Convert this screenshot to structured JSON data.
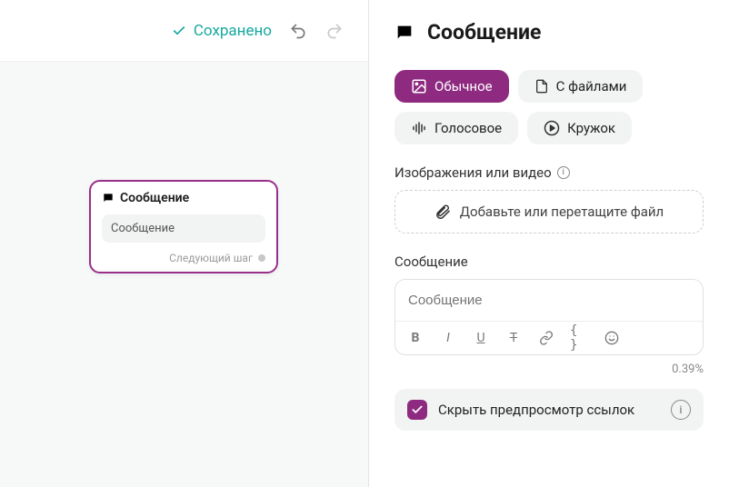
{
  "header": {
    "saved_label": "Сохранено"
  },
  "node": {
    "title": "Сообщение",
    "body": "Сообщение",
    "next_label": "Следующий шаг"
  },
  "panel": {
    "title": "Сообщение",
    "types": {
      "regular": "Обычное",
      "files": "С файлами",
      "voice": "Голосовое",
      "circle": "Кружок"
    },
    "media_label": "Изображения или видео",
    "dropzone_label": "Добавьте или перетащите файл",
    "message_label": "Сообщение",
    "message_placeholder": "Сообщение",
    "counter": "0.39%",
    "hide_preview_label": "Скрыть предпросмотр ссылок",
    "hide_preview_checked": true
  }
}
